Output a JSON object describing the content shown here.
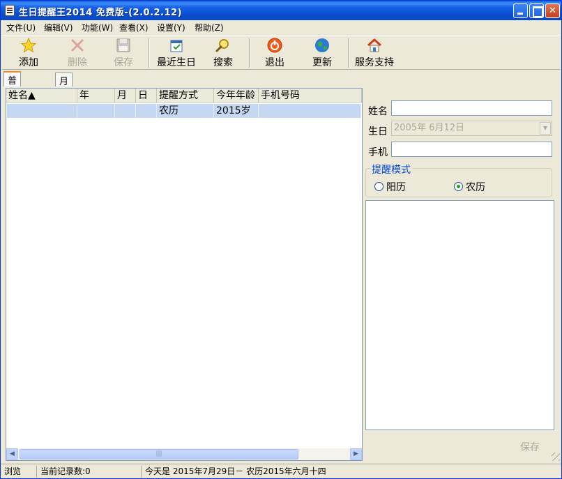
{
  "window": {
    "title": "生日提醒王2014 免费版-(2.0.2.12)"
  },
  "menu": [
    {
      "label": "文件(U)"
    },
    {
      "label": "编辑(V)"
    },
    {
      "label": "功能(W)"
    },
    {
      "label": "查看(X)"
    },
    {
      "label": "设置(Y)"
    },
    {
      "label": "帮助(Z)"
    }
  ],
  "toolbar": {
    "add": "添加",
    "delete": "删除",
    "save": "保存",
    "recent": "最近生日",
    "search": "搜索",
    "exit": "退出",
    "update": "更新",
    "support": "服务支持"
  },
  "tabs": [
    {
      "label": "普通视图"
    },
    {
      "label": "月历视图"
    }
  ],
  "table": {
    "headers": [
      "姓名▲",
      "年",
      "月",
      "日",
      "提醒方式",
      "今年年龄",
      "手机号码"
    ],
    "rows": [
      {
        "name": "",
        "year": "",
        "month": "",
        "day": "",
        "mode": "农历",
        "age": "2015岁",
        "phone": ""
      }
    ]
  },
  "scrollbar": {
    "left": "◀",
    "right": "▶",
    "thumb": "|||"
  },
  "form": {
    "name_label": "姓名",
    "name_value": "",
    "birthday_label": "生日",
    "birthday_value": "2005年  6月12日",
    "phone_label": "手机",
    "phone_value": "",
    "mode_title": "提醒模式",
    "mode_solar": "阳历",
    "mode_lunar": "农历",
    "mode_selected": "lunar",
    "save_label": "保存"
  },
  "status": {
    "mode": "浏览",
    "records": "当前记录数:0",
    "today": "今天是  2015年7月29日－ 农历2015年六月十四"
  }
}
